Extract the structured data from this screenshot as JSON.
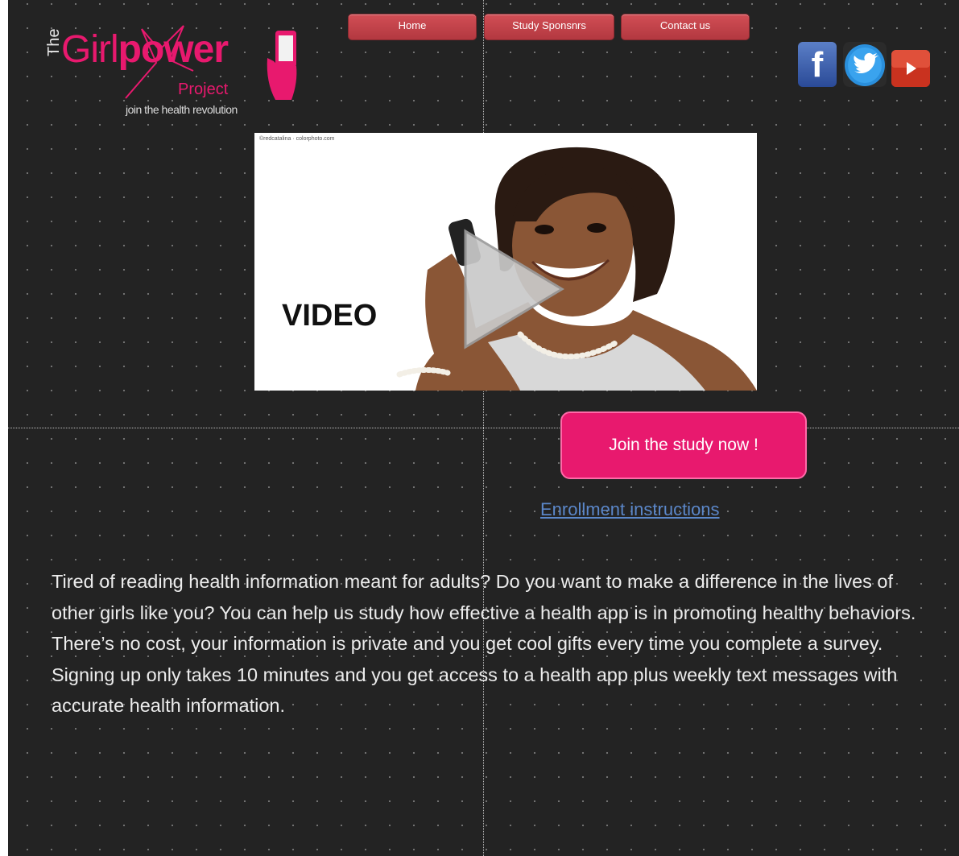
{
  "nav": {
    "home": "Home",
    "sponsors": "Study Sponsnrs",
    "contact": "Contact us"
  },
  "logo": {
    "prefix": "The",
    "word1": "Girl",
    "word2": "power",
    "word3": "Project",
    "tagline": "join the health revolution"
  },
  "social": {
    "facebook_icon": "facebook-icon",
    "twitter_icon": "twitter-icon",
    "youtube_icon": "youtube-icon",
    "facebook_letter": "f"
  },
  "video": {
    "caption": "©redcatalina · colorphoto.com",
    "label": "VIDEO"
  },
  "cta": {
    "join_label": "Join the study now !",
    "enroll_label": "Enrollment instructions"
  },
  "body_text": "Tired of reading health information  meant for adults? Do you want to make a difference in the lives of other girls like you? You can help us study how effective a health app is in promoting healthy behaviors. There’s no cost, your information is private and you get cool gifts every time you complete a survey. Signing up only takes 10 minutes and you get access to a health app plus weekly text messages with accurate health information.",
  "colors": {
    "background": "#232323",
    "brand_pink": "#e8196e",
    "nav_red": "#c4424a",
    "link_blue": "#5b87c9"
  }
}
